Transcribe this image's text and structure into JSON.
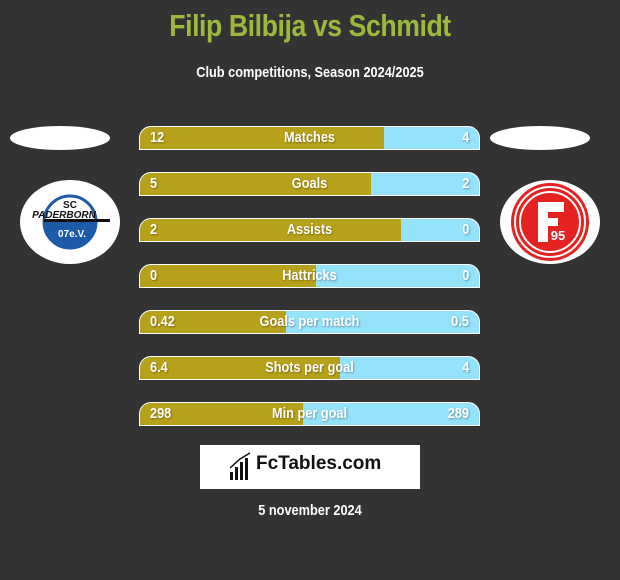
{
  "header": {
    "title": "Filip Bilbija vs Schmidt",
    "subtitle": "Club competitions, Season 2024/2025"
  },
  "left_team": {
    "name": "SC Paderborn 07",
    "logo_text_top": "SC",
    "logo_text_mid": "PADERBORN",
    "logo_text_bottom": "07e.V."
  },
  "right_team": {
    "name": "Fortuna Düsseldorf",
    "logo_text": "95"
  },
  "colors": {
    "left": "#b8a11a",
    "right": "#95e2fb",
    "title": "#9db83b",
    "background": "#333333"
  },
  "stats": [
    {
      "label": "Matches",
      "left": "12",
      "right": "4",
      "left_share": 0.72
    },
    {
      "label": "Goals",
      "left": "5",
      "right": "2",
      "left_share": 0.68
    },
    {
      "label": "Assists",
      "left": "2",
      "right": "0",
      "left_share": 0.77
    },
    {
      "label": "Hattricks",
      "left": "0",
      "right": "0",
      "left_share": 0.52
    },
    {
      "label": "Goals per match",
      "left": "0.42",
      "right": "0.5",
      "left_share": 0.43
    },
    {
      "label": "Shots per goal",
      "left": "6.4",
      "right": "4",
      "left_share": 0.59
    },
    {
      "label": "Min per goal",
      "left": "298",
      "right": "289",
      "left_share": 0.48
    }
  ],
  "brand": {
    "name": "FcTables.com",
    "icon": "bar-chart-icon"
  },
  "footer": {
    "date": "5 november 2024"
  }
}
